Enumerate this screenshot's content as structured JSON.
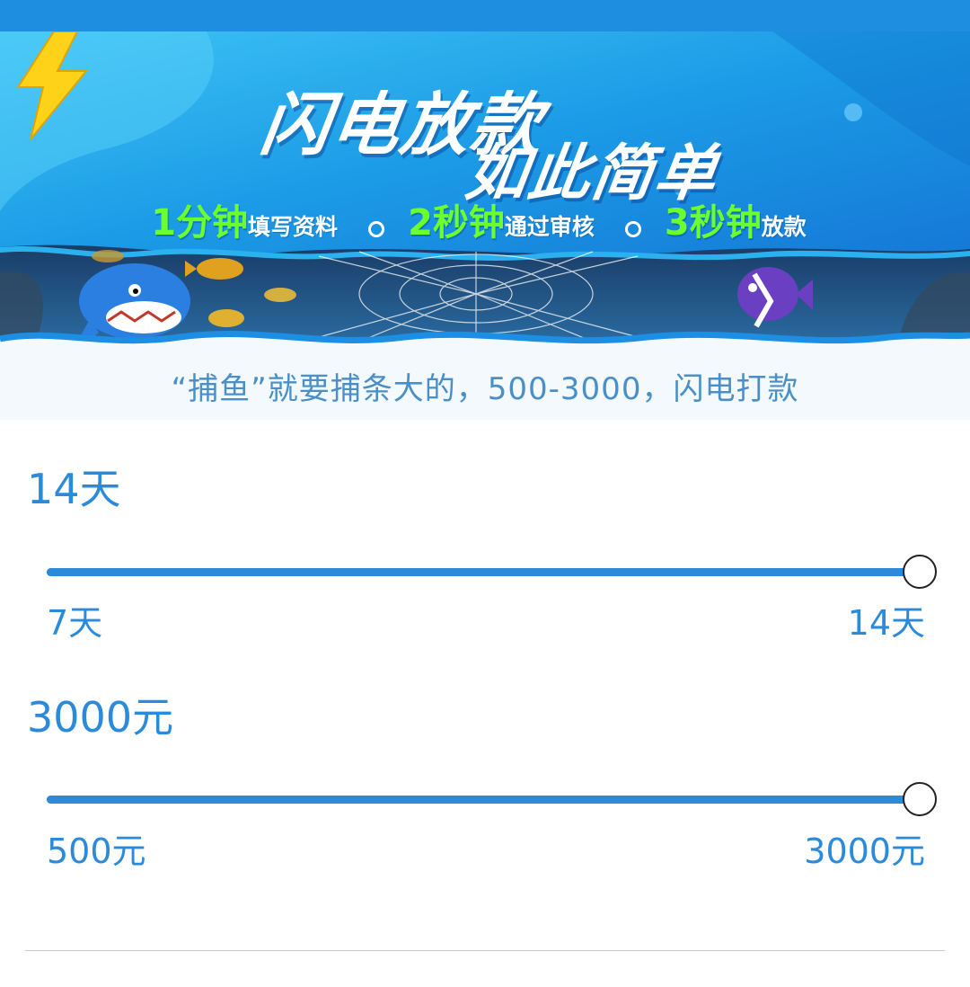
{
  "banner": {
    "headline_line1": "闪电放款",
    "headline_line2": "如此简单",
    "steps": [
      {
        "big": "1分钟",
        "small": "填写资料"
      },
      {
        "big": "2秒钟",
        "small": "通过审核"
      },
      {
        "big": "3秒钟",
        "small": "放款"
      }
    ],
    "tagline": "“捕鱼”就要捕条大的，500-3000，闪电打款"
  },
  "term": {
    "value_label": "14天",
    "min_label": "7天",
    "max_label": "14天",
    "fraction": 1.0
  },
  "amount": {
    "value_label": "3000元",
    "min_label": "500元",
    "max_label": "3000元",
    "fraction": 1.0
  },
  "colors": {
    "status_bar": "#1e8fe0",
    "accent": "#2b8ad9",
    "step_highlight": "#6cff2e"
  }
}
